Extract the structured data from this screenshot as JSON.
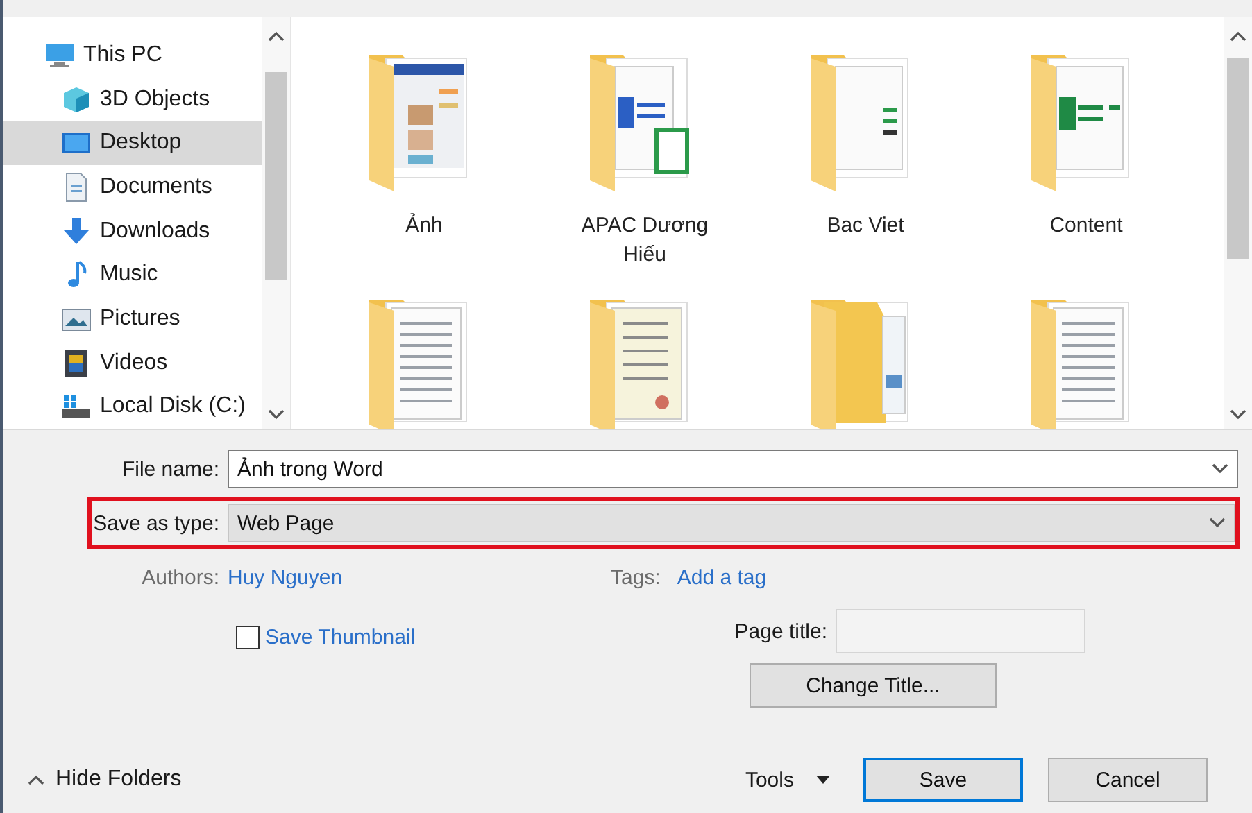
{
  "navigation": {
    "items": [
      {
        "label": "This PC",
        "kind": "pc",
        "selected": false
      },
      {
        "label": "3D Objects",
        "kind": "objects",
        "selected": false
      },
      {
        "label": "Desktop",
        "kind": "desktop",
        "selected": true
      },
      {
        "label": "Documents",
        "kind": "documents",
        "selected": false
      },
      {
        "label": "Downloads",
        "kind": "downloads",
        "selected": false
      },
      {
        "label": "Music",
        "kind": "music",
        "selected": false
      },
      {
        "label": "Pictures",
        "kind": "pictures",
        "selected": false
      },
      {
        "label": "Videos",
        "kind": "videos",
        "selected": false
      },
      {
        "label": "Local Disk (C:)",
        "kind": "disk",
        "selected": false
      }
    ]
  },
  "folders": [
    {
      "name": "Ảnh",
      "kind": "photos"
    },
    {
      "name": "APAC Dương Hiếu",
      "kind": "word"
    },
    {
      "name": "Bac Viet",
      "kind": "sheets"
    },
    {
      "name": "Content",
      "kind": "excel"
    },
    {
      "kind": "scan"
    },
    {
      "kind": "certificate"
    },
    {
      "kind": "stack"
    },
    {
      "kind": "scan"
    }
  ],
  "form": {
    "file_name": {
      "label": "File name:",
      "value": "Ảnh trong Word"
    },
    "save_as_type": {
      "label": "Save as type:",
      "value": "Web Page",
      "highlighted": true
    },
    "authors": {
      "label": "Authors:",
      "value": "Huy Nguyen"
    },
    "tags": {
      "label": "Tags:",
      "value": "Add a tag"
    },
    "save_thumbnail": {
      "label": "Save Thumbnail",
      "checked": false
    },
    "page_title": {
      "label": "Page title:"
    },
    "change_title_button": "Change Title..."
  },
  "footer": {
    "hide_folders": "Hide Folders",
    "tools": "Tools",
    "buttons": [
      {
        "label": "Save",
        "kind": "default"
      },
      {
        "label": "Cancel",
        "kind": "normal"
      }
    ]
  }
}
